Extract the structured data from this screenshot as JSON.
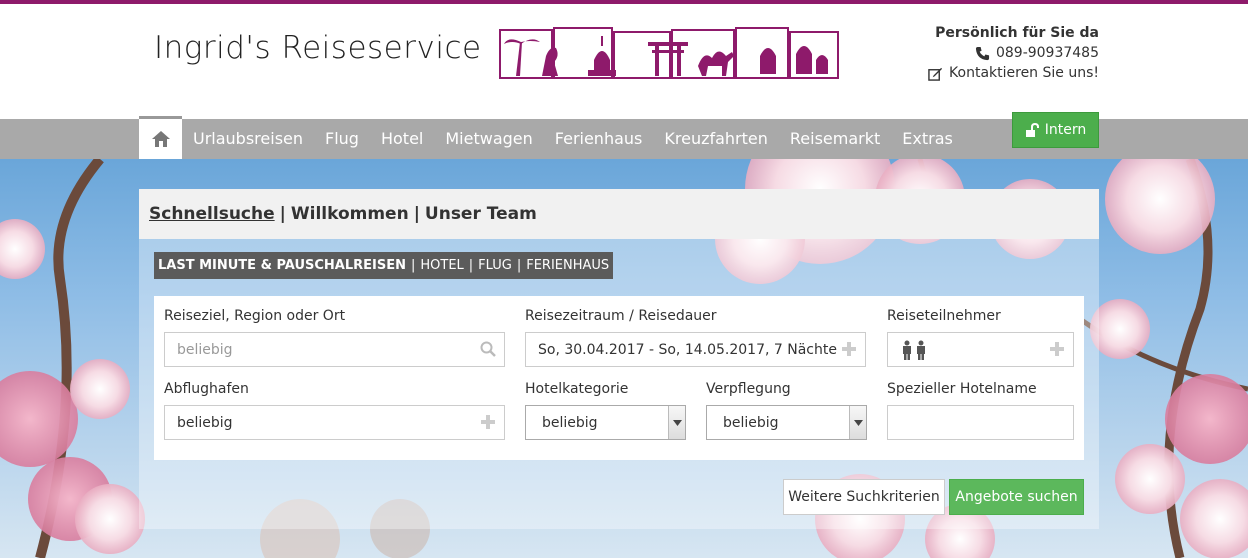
{
  "brand": {
    "name": "Ingrid's Reiseservice"
  },
  "contact": {
    "title": "Persönlich für Sie da",
    "phone": "089-90937485",
    "contact_link": "Kontaktieren Sie uns!"
  },
  "nav": {
    "items": [
      "Urlaubsreisen",
      "Flug",
      "Hotel",
      "Mietwagen",
      "Ferienhaus",
      "Kreuzfahrten",
      "Reisemarkt",
      "Extras"
    ],
    "intern_label": "Intern"
  },
  "panel": {
    "tabs": [
      "Schnellsuche",
      "Willkommen",
      "Unser Team"
    ],
    "subtabs": [
      "LAST MINUTE & PAUSCHALREISEN",
      "HOTEL",
      "FLUG",
      "FERIENHAUS"
    ]
  },
  "form": {
    "destination": {
      "label": "Reiseziel, Region oder Ort",
      "placeholder": "beliebig"
    },
    "period": {
      "label": "Reisezeitraum / Reisedauer",
      "value": "So, 30.04.2017 - So, 14.05.2017, 7 Nächte"
    },
    "travellers": {
      "label": "Reiseteilnehmer"
    },
    "airport": {
      "label": "Abflughafen",
      "value": "beliebig"
    },
    "hotel_category": {
      "label": "Hotelkategorie",
      "value": "beliebig"
    },
    "board": {
      "label": "Verpflegung",
      "value": "beliebig"
    },
    "hotel_name": {
      "label": "Spezieller Hotelname",
      "value": ""
    }
  },
  "buttons": {
    "more_criteria": "Weitere Suchkriterien",
    "search": "Angebote suchen"
  },
  "colors": {
    "brand": "#8e1a6b",
    "nav": "#a9a9a9",
    "success": "#5cb85c"
  },
  "icons": [
    "home-icon",
    "phone-icon",
    "edit-icon",
    "unlock-icon",
    "search-icon",
    "plus-icon",
    "persons-icon",
    "chevron-down-icon"
  ]
}
